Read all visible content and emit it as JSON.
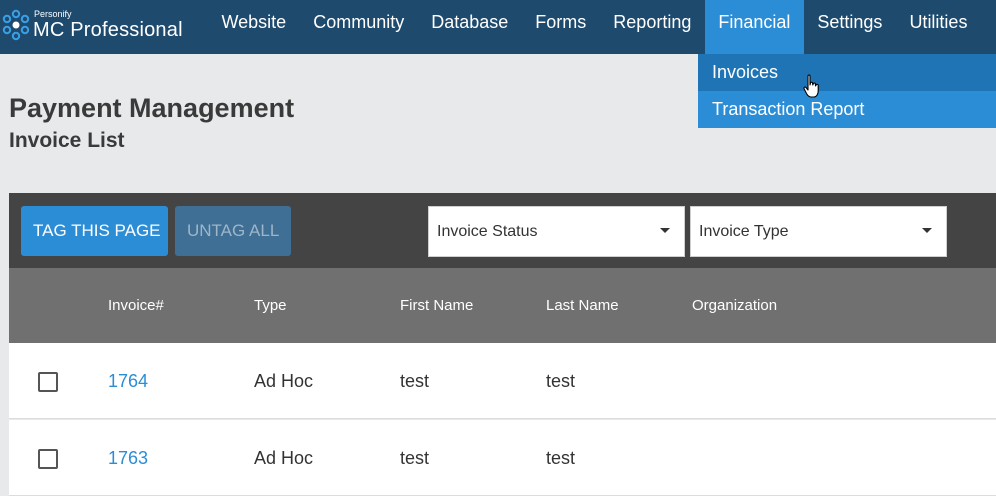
{
  "app": {
    "logo_small": "Personify",
    "logo_main": "MC Professional"
  },
  "nav": {
    "items": [
      {
        "label": "Website"
      },
      {
        "label": "Community"
      },
      {
        "label": "Database"
      },
      {
        "label": "Forms"
      },
      {
        "label": "Reporting"
      },
      {
        "label": "Financial"
      },
      {
        "label": "Settings"
      },
      {
        "label": "Utilities"
      }
    ],
    "active": "Financial"
  },
  "dropdown": {
    "items": [
      {
        "label": "Invoices"
      },
      {
        "label": "Transaction Report"
      }
    ],
    "hovered": "Invoices"
  },
  "page": {
    "title": "Payment Management",
    "subtitle": "Invoice List"
  },
  "toolbar": {
    "tag_label": "TAG THIS PAGE",
    "untag_label": "UNTAG ALL",
    "status_select": "Invoice Status",
    "type_select": "Invoice Type"
  },
  "table": {
    "columns": [
      "Invoice#",
      "Type",
      "First Name",
      "Last Name",
      "Organization"
    ],
    "rows": [
      {
        "invoice": "1764",
        "type": "Ad Hoc",
        "first": "test",
        "last": "test",
        "org": ""
      },
      {
        "invoice": "1763",
        "type": "Ad Hoc",
        "first": "test",
        "last": "test",
        "org": ""
      }
    ]
  },
  "colors": {
    "topbar": "#1e4a6e",
    "accent": "#2b8dd6",
    "toolbar": "#444444",
    "table_header": "#707070"
  }
}
